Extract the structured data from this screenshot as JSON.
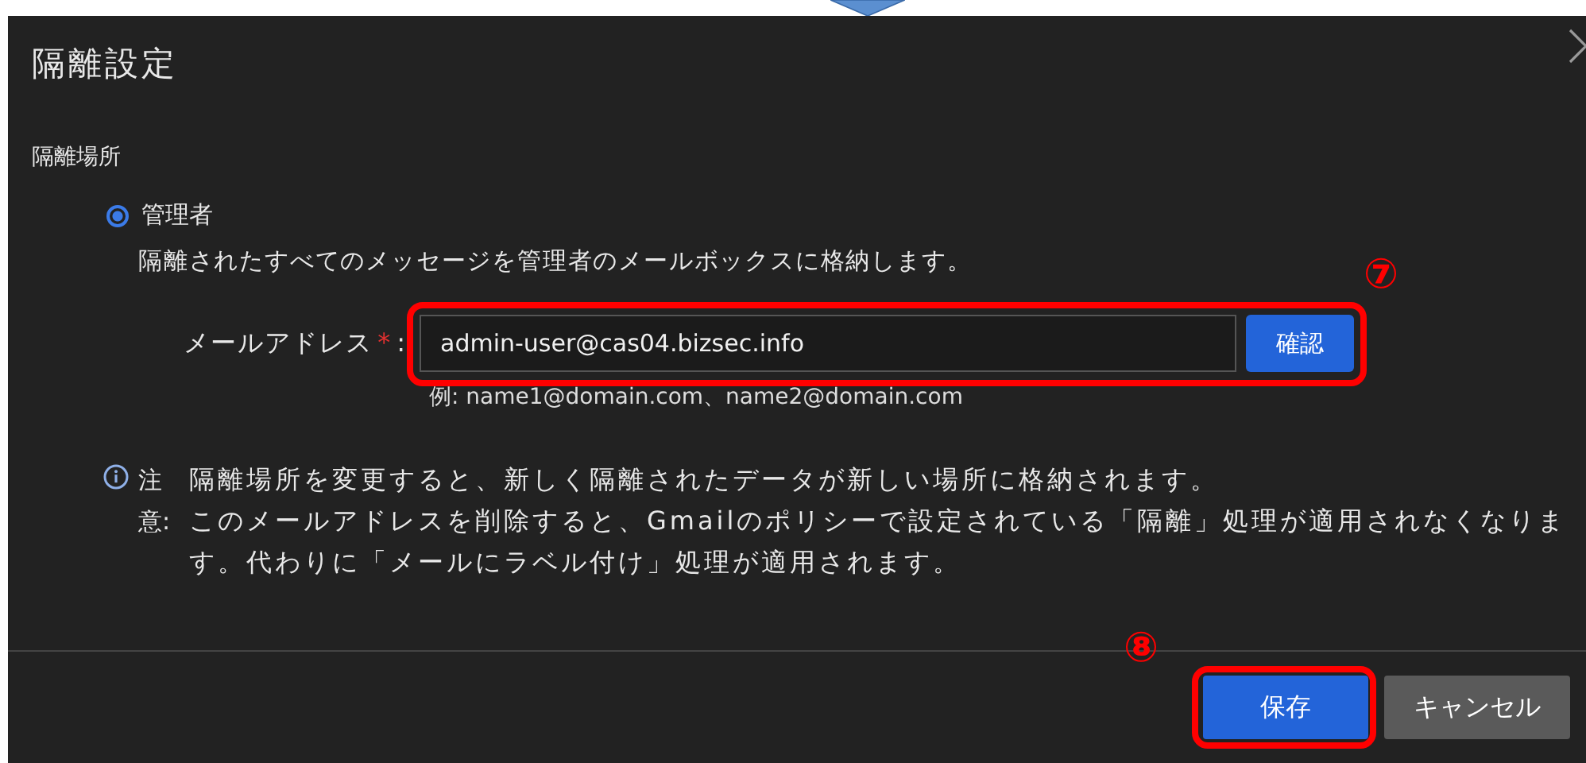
{
  "dialog": {
    "title": "隔離設定"
  },
  "section": {
    "heading": "隔離場所"
  },
  "options": [
    {
      "label": "管理者",
      "description": "隔離されたすべてのメッセージを管理者のメールボックスに格納します。",
      "selected": true
    }
  ],
  "email_field": {
    "label": "メールアドレス",
    "required_mark": "*",
    "separator": ":",
    "value": "admin-user@cas04.bizsec.info",
    "hint": "例: name1@domain.com、name2@domain.com",
    "button": "確認"
  },
  "note": {
    "label": "注意:",
    "lines": [
      "隔離場所を変更すると、新しく隔離されたデータが新しい場所に格納されます。",
      "このメールアドレスを削除すると、Gmailのポリシーで設定されている「隔離」処理が適用されなくなります。代わりに「メールにラベル付け」処理が適用されます。"
    ]
  },
  "footer": {
    "buttons": [
      {
        "label": "保存",
        "kind": "primary"
      },
      {
        "label": "キャンセル",
        "kind": "secondary"
      }
    ]
  },
  "annotations": [
    {
      "number": "⑦"
    },
    {
      "number": "⑧"
    }
  ]
}
